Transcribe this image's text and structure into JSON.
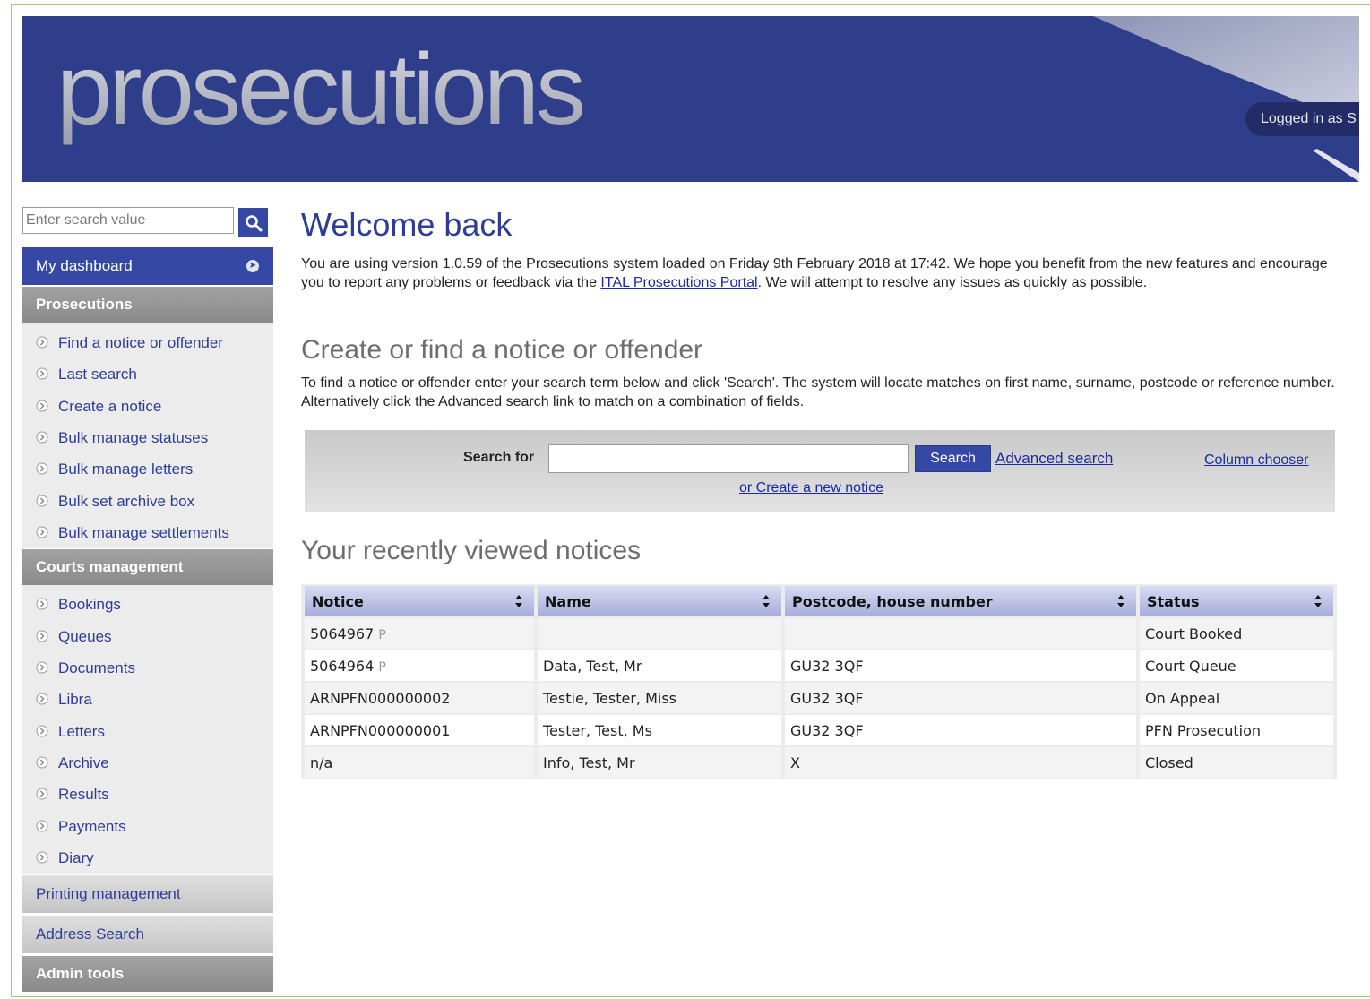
{
  "banner": {
    "title": "prosecutions",
    "logged_in": "Logged in as S"
  },
  "sidebar": {
    "search_placeholder": "Enter search value",
    "dashboard": "My dashboard",
    "sections": [
      {
        "title": "Prosecutions",
        "items": [
          "Find a notice or offender",
          "Last search",
          "Create a notice",
          "Bulk manage statuses",
          "Bulk manage letters",
          "Bulk set archive box",
          "Bulk manage settlements"
        ]
      },
      {
        "title": "Courts management",
        "items": [
          "Bookings",
          "Queues",
          "Documents",
          "Libra",
          "Letters",
          "Archive",
          "Results",
          "Payments",
          "Diary"
        ]
      }
    ],
    "collapsed": [
      "Printing management",
      "Address Search",
      "Admin tools"
    ]
  },
  "main": {
    "welcome_title": "Welcome back",
    "welcome_pre": "You are using version 1.0.59 of the Prosecutions system loaded on Friday 9th February 2018 at 17:42. We hope you benefit from the new features and encourage you to report any problems or feedback via the ",
    "welcome_link": "ITAL Prosecutions Portal",
    "welcome_post": ". We will attempt to resolve any issues as quickly as possible.",
    "find_title": "Create or find a notice or offender",
    "find_text": "To find a notice or offender enter your search term below and click 'Search'. The system will locate matches on first name, surname, postcode or reference number. Alternatively click the Advanced search link to match on a combination of fields.",
    "search_label": "Search for",
    "search_value": "",
    "search_button": "Search",
    "advanced_link": "Advanced search",
    "column_chooser": "Column chooser",
    "create_new": "or Create a new notice",
    "recent_title": "Your recently viewed notices"
  },
  "table": {
    "columns": [
      "Notice",
      "Name",
      "Postcode, house number",
      "Status"
    ],
    "rows": [
      {
        "notice": "5064967",
        "flag": "P",
        "name": "",
        "postcode": "",
        "status": "Court Booked"
      },
      {
        "notice": "5064964",
        "flag": "P",
        "name": "Data, Test, Mr",
        "postcode": "GU32 3QF",
        "status": "Court Queue"
      },
      {
        "notice": "ARNPFN000000002",
        "flag": "",
        "name": "Testie, Tester, Miss",
        "postcode": "GU32 3QF",
        "status": "On Appeal"
      },
      {
        "notice": "ARNPFN000000001",
        "flag": "",
        "name": "Tester, Test, Ms",
        "postcode": "GU32 3QF",
        "status": "PFN Prosecution"
      },
      {
        "notice": "n/a",
        "flag": "",
        "name": "Info, Test, Mr",
        "postcode": "X",
        "status": "Closed"
      }
    ]
  },
  "colors": {
    "banner": "#2f3e8a",
    "accent": "#3548a3",
    "link": "#2d3d96"
  },
  "icons": {
    "search": "magnifier-icon",
    "nav_arrow": "circle-chevron-right-icon",
    "sort": "sort-updown-icon"
  }
}
